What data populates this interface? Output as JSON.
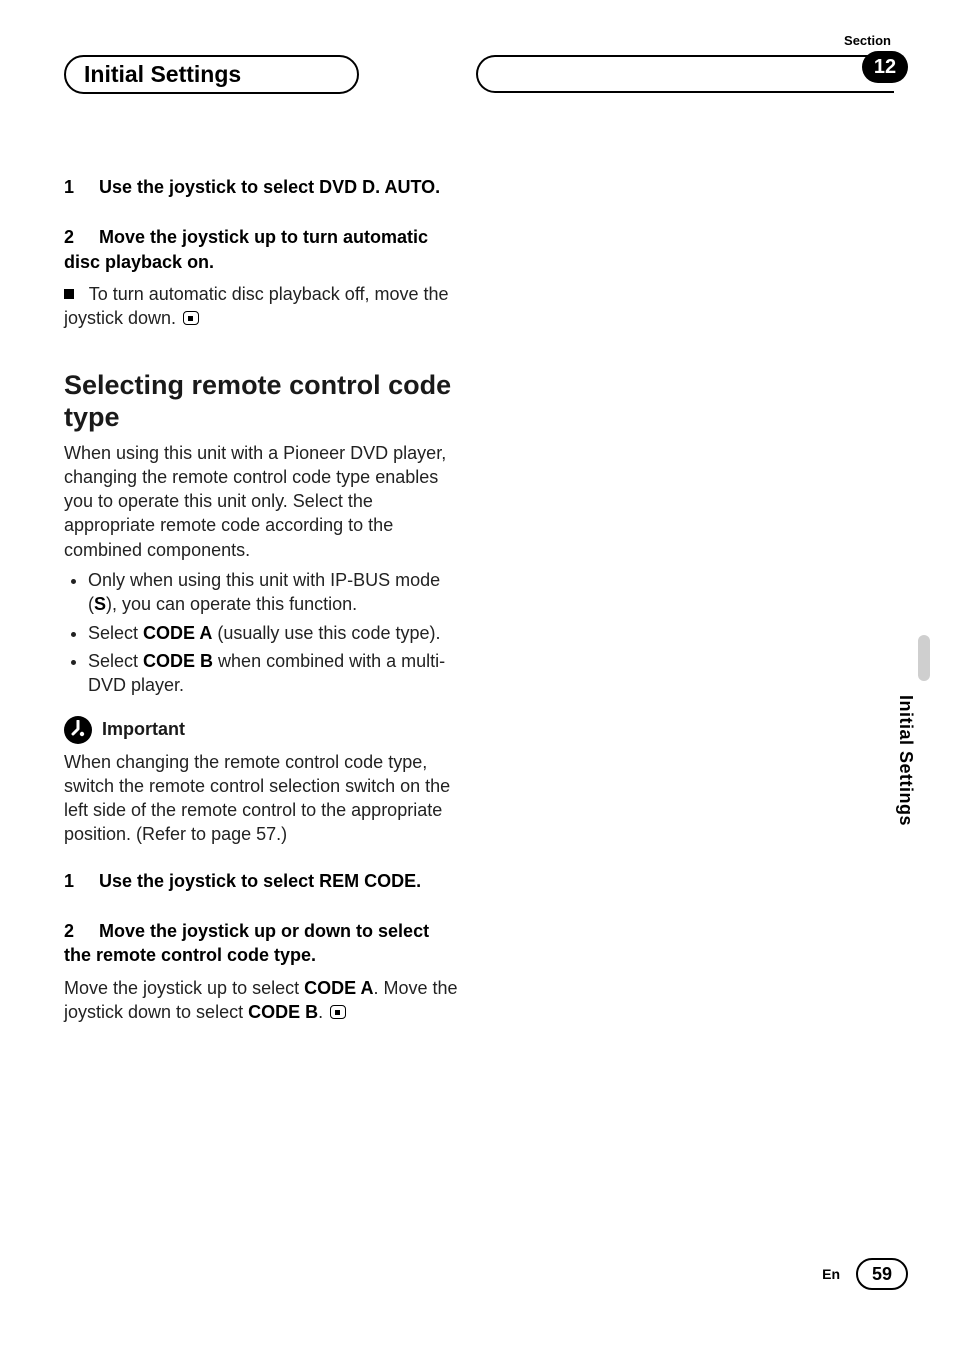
{
  "header": {
    "section_label": "Section",
    "left_title": "Initial Settings",
    "section_number": "12"
  },
  "side_tab": "Initial Settings",
  "steps_a": {
    "s1": {
      "num": "1",
      "text": "Use the joystick to select DVD D. AUTO."
    },
    "s2": {
      "num": "2",
      "text": "Move the joystick up to turn automatic disc playback on."
    },
    "note": "To turn automatic disc playback off, move the joystick down."
  },
  "section_b": {
    "heading": "Selecting remote control code type",
    "intro": "When using this unit with a Pioneer DVD player, changing the remote control code type enables you to operate this unit only. Select the appropriate remote code according to the combined components.",
    "bullets": {
      "b1_pre": "Only when using this unit with IP-BUS mode (",
      "b1_bold": "S",
      "b1_post": "), you can operate this function.",
      "b2_pre": "Select ",
      "b2_bold": "CODE A",
      "b2_post": " (usually use this code type).",
      "b3_pre": "Select ",
      "b3_bold": "CODE B",
      "b3_post": " when combined with a multi-DVD player."
    },
    "important_label": "Important",
    "important_text": "When changing the remote control code type, switch the remote control selection switch on the left side of the remote control to the appropriate position. (Refer to page 57.)",
    "s1": {
      "num": "1",
      "text": "Use the joystick to select REM CODE."
    },
    "s2": {
      "num": "2",
      "text": "Move the joystick up or down to select the remote control code type."
    },
    "s2_detail_pre": "Move the joystick up to select ",
    "s2_detail_bold1": "CODE A",
    "s2_detail_mid": ". Move the joystick down to select ",
    "s2_detail_bold2": "CODE B",
    "s2_detail_post": "."
  },
  "footer": {
    "lang": "En",
    "page": "59"
  }
}
